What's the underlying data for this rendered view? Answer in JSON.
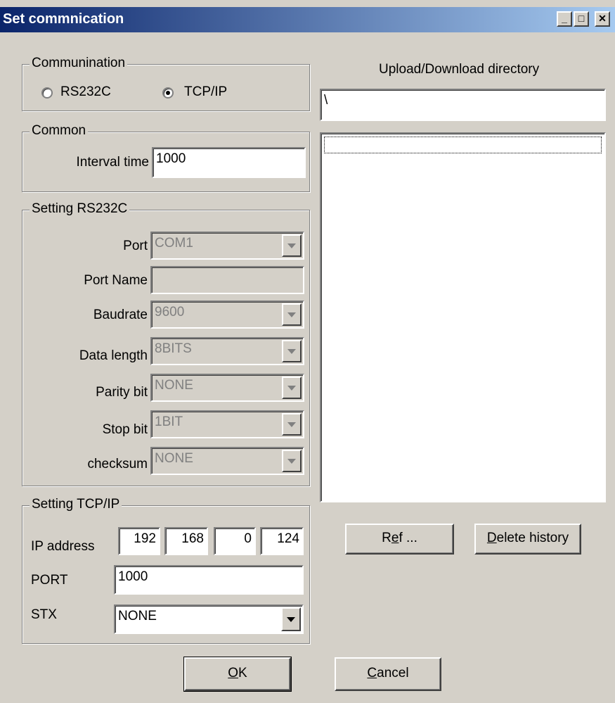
{
  "window": {
    "title": "Set commnication"
  },
  "titlebar": {
    "minimize_glyph": "_",
    "maximize_glyph": "□",
    "close_glyph": "✕"
  },
  "communication": {
    "legend": "Communination",
    "options": [
      {
        "label": "RS232C",
        "selected": false
      },
      {
        "label": "TCP/IP",
        "selected": true
      }
    ]
  },
  "common": {
    "legend": "Common",
    "interval_label": "Interval time",
    "interval_value": "1000"
  },
  "rs232c": {
    "legend": "Setting RS232C",
    "port_label": "Port",
    "port_value": "COM1",
    "port_name_label": "Port Name",
    "port_name_value": "",
    "baudrate_label": "Baudrate",
    "baudrate_value": "9600",
    "data_length_label": "Data length",
    "data_length_value": "8BITS",
    "parity_label": "Parity bit",
    "parity_value": "NONE",
    "stop_bit_label": "Stop bit",
    "stop_bit_value": "1BIT",
    "checksum_label": "checksum",
    "checksum_value": "NONE"
  },
  "tcpip": {
    "legend": "Setting TCP/IP",
    "ip_label": "IP address",
    "ip_octets": [
      "192",
      "168",
      "0",
      "124"
    ],
    "port_label": "PORT",
    "port_value": "1000",
    "stx_label": "STX",
    "stx_value": "NONE"
  },
  "directory": {
    "title": "Upload/Download directory",
    "path_value": "\\",
    "history": []
  },
  "buttons": {
    "ref": {
      "pre": "R",
      "u": "e",
      "post": "f ..."
    },
    "delete": {
      "pre": "",
      "u": "D",
      "post": "elete history"
    },
    "ok": {
      "pre": "",
      "u": "O",
      "post": "K"
    },
    "cancel": {
      "pre": "",
      "u": "C",
      "post": "ancel"
    }
  },
  "colors": {
    "dialog_bg": "#d4d0c8",
    "title_start": "#0a246a",
    "title_end": "#a6caf0",
    "disabled_text": "#808080"
  }
}
